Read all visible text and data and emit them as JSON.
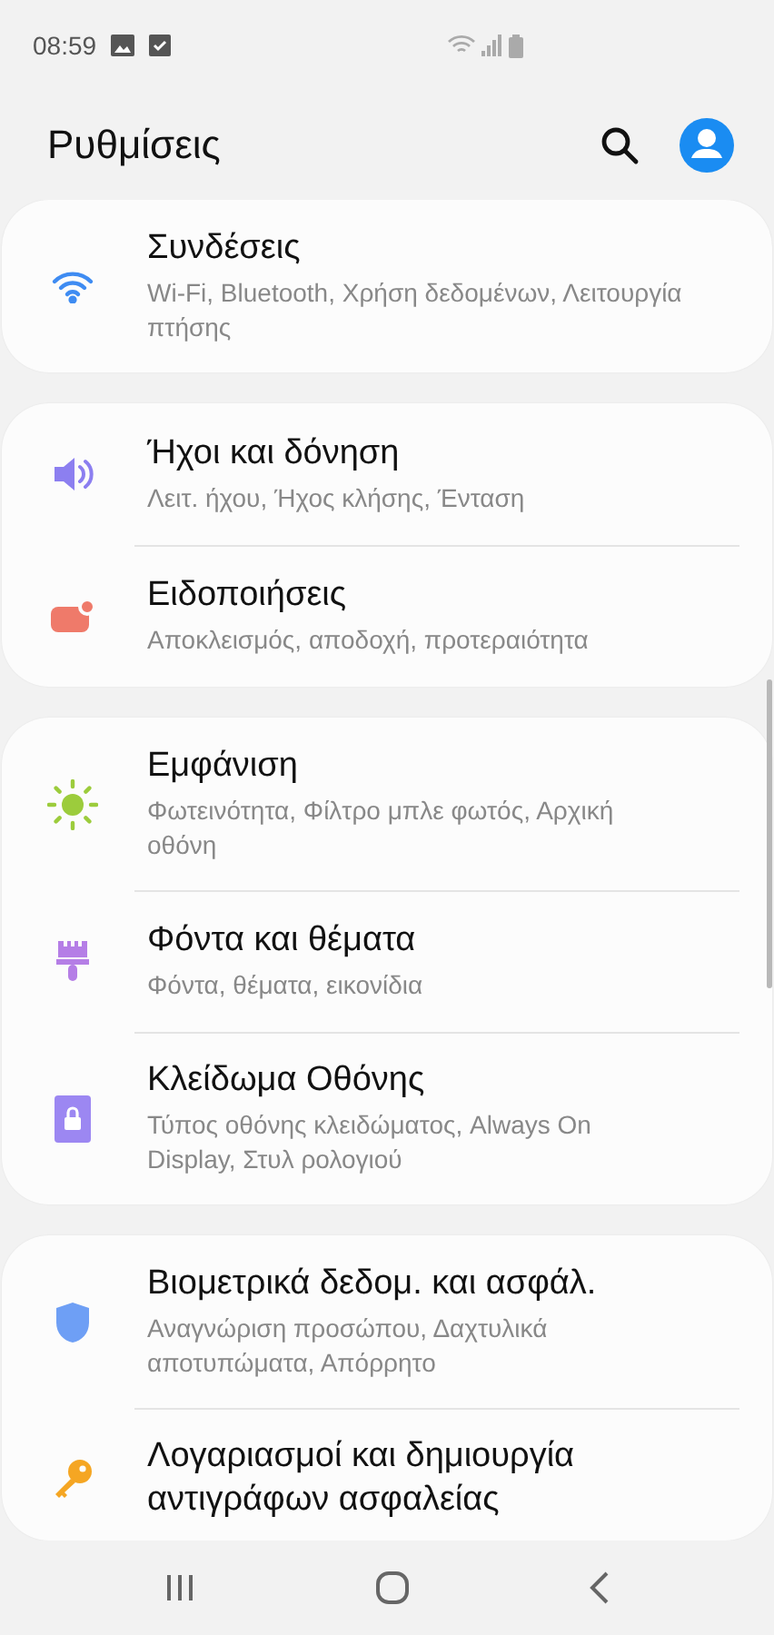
{
  "status_bar": {
    "time": "08:59"
  },
  "header": {
    "title": "Ρυθμίσεις"
  },
  "groups": [
    {
      "items": [
        {
          "kind": "wifi",
          "color": "#3f8cf2",
          "title": "Συνδέσεις",
          "subtitle": "Wi-Fi, Bluetooth, Χρήση δεδομένων, Λειτουργία πτήσης"
        }
      ]
    },
    {
      "items": [
        {
          "kind": "sound",
          "color": "#8c7ff0",
          "title": "Ήχοι και δόνηση",
          "subtitle": "Λειτ. ήχου, Ήχος κλήσης, Ένταση"
        },
        {
          "kind": "notification",
          "color": "#ef7a6a",
          "title": "Ειδοποιήσεις",
          "subtitle": "Αποκλεισμός, αποδοχή, προτεραιότητα"
        }
      ]
    },
    {
      "items": [
        {
          "kind": "display",
          "color": "#9ccc3c",
          "title": "Εμφάνιση",
          "subtitle": "Φωτεινότητα, Φίλτρο μπλε φωτός, Αρχική οθόνη"
        },
        {
          "kind": "brush",
          "color": "#b57ee6",
          "title": "Φόντα και θέματα",
          "subtitle": "Φόντα, θέματα, εικονίδια"
        },
        {
          "kind": "lock",
          "color": "#9c87f2",
          "title": "Κλείδωμα Οθόνης",
          "subtitle": "Τύπος οθόνης κλειδώματος, Always On Display, Στυλ ρολογιού"
        }
      ]
    },
    {
      "items": [
        {
          "kind": "shield",
          "color": "#6e9ff5",
          "title": "Βιομετρικά δεδομ. και ασφάλ.",
          "subtitle": "Αναγνώριση προσώπου, Δαχτυλικά αποτυπώματα, Απόρρητο"
        },
        {
          "kind": "key",
          "color": "#f5a623",
          "title": "Λογαριασμοί και δημιουργία αντιγράφων ασφαλείας"
        }
      ]
    }
  ]
}
